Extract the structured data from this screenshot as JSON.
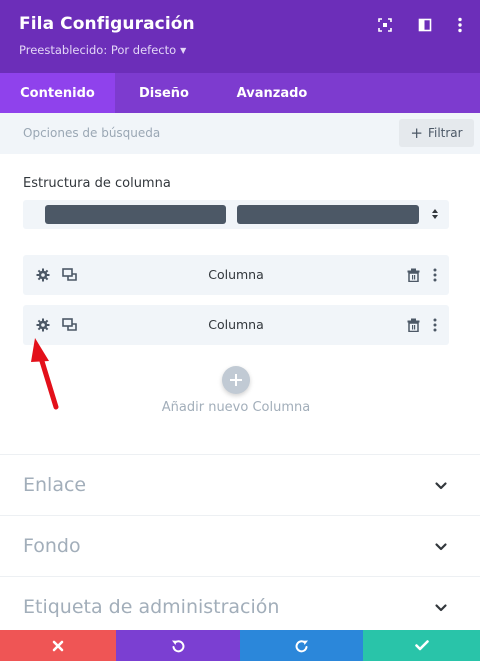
{
  "header": {
    "title": "Fila Configuración",
    "preset": "Preestablecido: Por defecto",
    "bg_color": "#6c2eb9",
    "icons": [
      "focus-icon",
      "sidebar-toggle-icon",
      "more-vertical-icon"
    ]
  },
  "tabs": [
    {
      "label": "Contenido",
      "active": true
    },
    {
      "label": "Diseño",
      "active": false
    },
    {
      "label": "Avanzado",
      "active": false
    }
  ],
  "search": {
    "placeholder": "Opciones de búsqueda",
    "filter_label": "Filtrar"
  },
  "column_structure": {
    "label": "Estructura de columna",
    "columns": 2
  },
  "columns": [
    {
      "label": "Columna"
    },
    {
      "label": "Columna"
    }
  ],
  "add_column": {
    "label": "Añadir nuevo Columna"
  },
  "toggles": [
    {
      "label": "Enlace"
    },
    {
      "label": "Fondo"
    },
    {
      "label": "Etiqueta de administración"
    }
  ],
  "footer": {
    "buttons": [
      {
        "name": "cancel",
        "icon": "close-icon",
        "color": "#ef5555"
      },
      {
        "name": "undo",
        "icon": "undo-icon",
        "color": "#7b3fd2"
      },
      {
        "name": "redo",
        "icon": "redo-icon",
        "color": "#2b87da"
      },
      {
        "name": "save",
        "icon": "check-icon",
        "color": "#29c4a9"
      }
    ]
  },
  "annotation": {
    "color": "#e3101a",
    "points_to": "column-1-settings"
  }
}
